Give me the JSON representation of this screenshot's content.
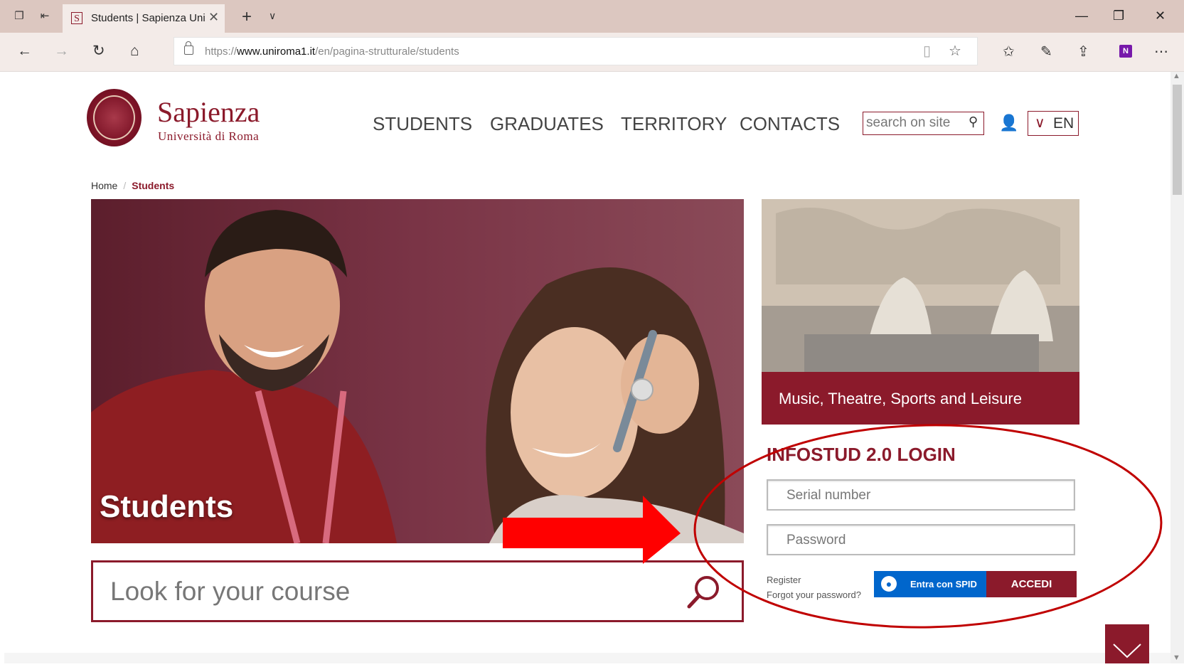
{
  "browser": {
    "tab_title": "Students | Sapienza Uni",
    "tab_favicon": "S",
    "url_prefix": "https://",
    "url_host": "www.uniroma1.it",
    "url_path": "/en/pagina-strutturale/students"
  },
  "site": {
    "brand_main": "Sapienza",
    "brand_sub": "Università di Roma",
    "menu": [
      "STUDENTS",
      "GRADUATES",
      "TERRITORY",
      "CONTACTS"
    ],
    "search_placeholder": "search on site",
    "lang": "EN"
  },
  "breadcrumb": {
    "home": "Home",
    "sep": "/",
    "current": "Students"
  },
  "hero": {
    "title": "Students"
  },
  "course_search": {
    "placeholder": "Look for your course"
  },
  "card": {
    "caption": "Music, Theatre, Sports and Leisure"
  },
  "login": {
    "title": "INFOSTUD 2.0 LOGIN",
    "serial_placeholder": "Serial number",
    "password_placeholder": "Password",
    "register": "Register",
    "forgot": "Forgot your password?",
    "spid_label": "Entra con SPID",
    "submit": "ACCEDI"
  },
  "colors": {
    "brand": "#8b1a2b",
    "spid": "#0066cc",
    "annotation_arrow": "#ff0000",
    "annotation_ellipse": "#c00000"
  }
}
